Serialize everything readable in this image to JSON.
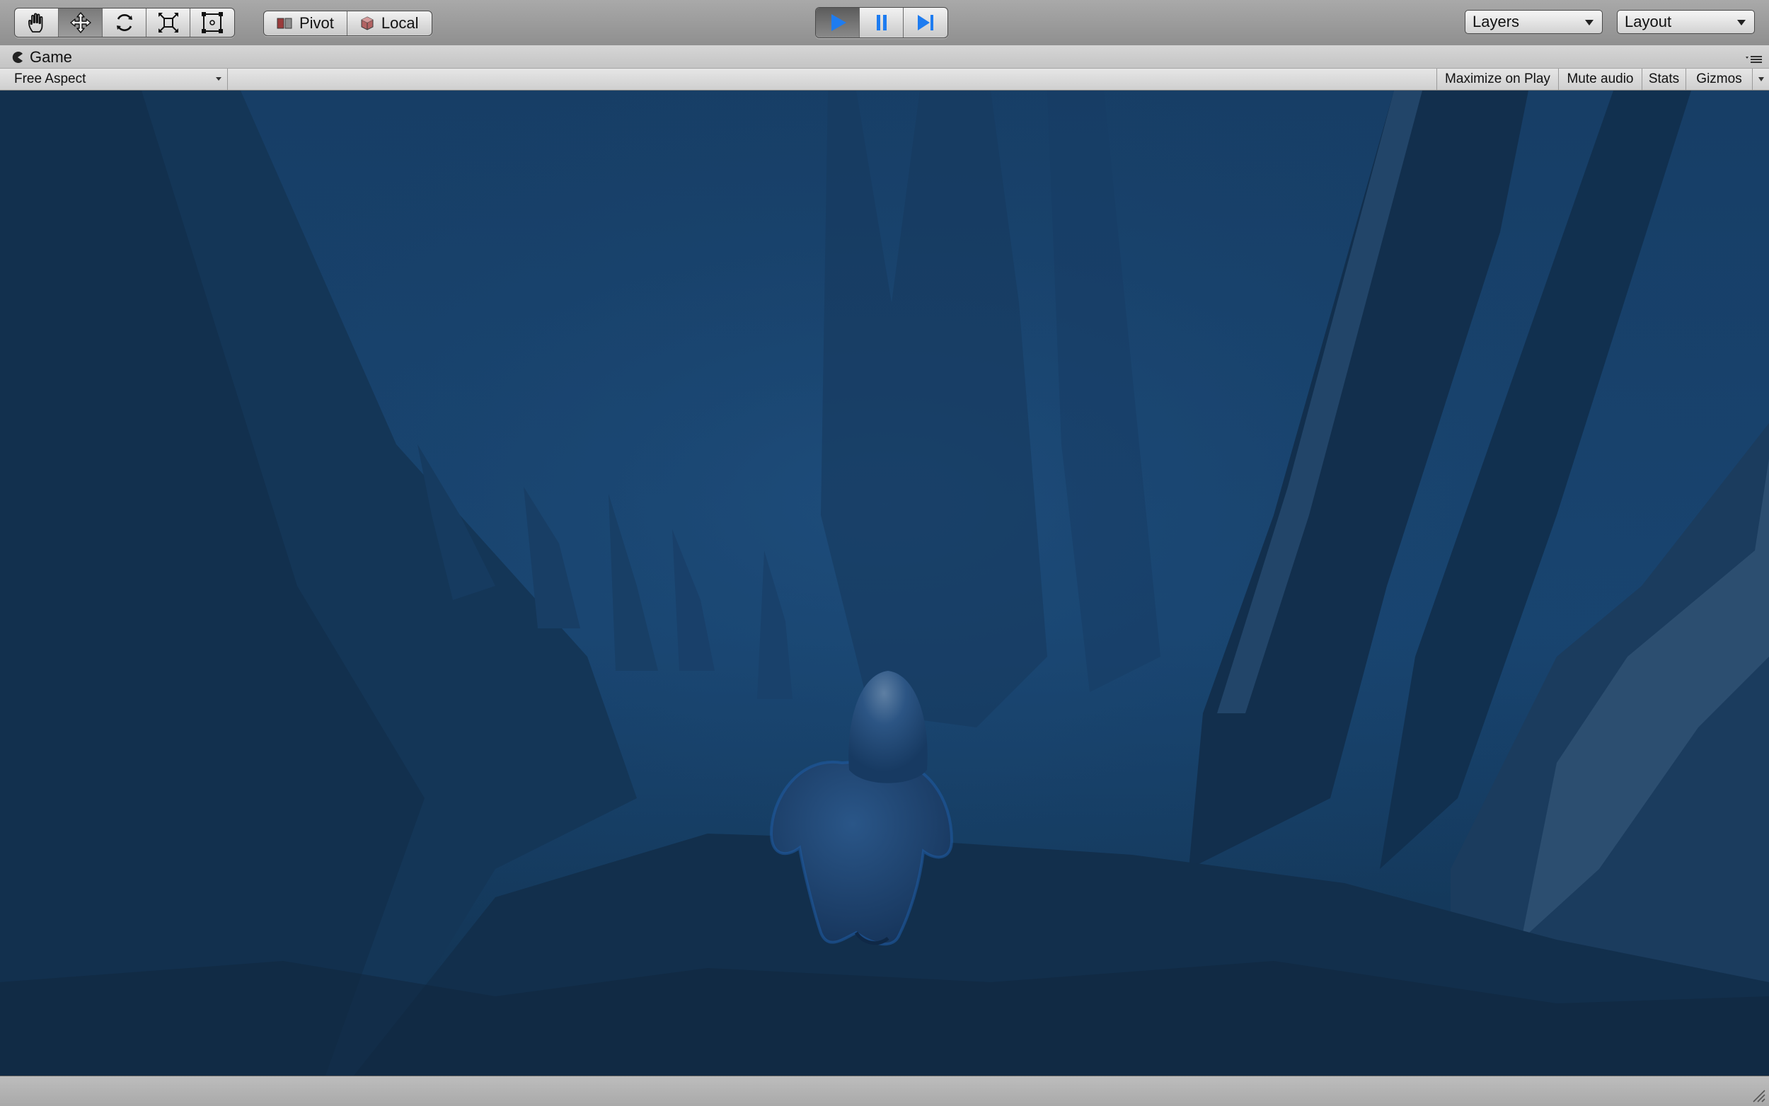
{
  "toolbar": {
    "tools": [
      "hand-icon",
      "move-icon",
      "rotate-icon",
      "scale-icon",
      "rect-tool-icon"
    ],
    "active_tool": "move-icon",
    "pivot_label": "Pivot",
    "local_label": "Local",
    "play_controls": [
      "play-icon",
      "pause-icon",
      "step-icon"
    ],
    "layers_label": "Layers",
    "layout_label": "Layout",
    "accent_color": "#1e7cf0"
  },
  "game_window": {
    "tab_label": "Game",
    "aspect_label": "Free Aspect",
    "maximize_label": "Maximize on Play",
    "mute_label": "Mute audio",
    "stats_label": "Stats",
    "gizmos_label": "Gizmos"
  },
  "scene": {
    "water_color": "#173f66",
    "character_color": "#1f4878"
  }
}
